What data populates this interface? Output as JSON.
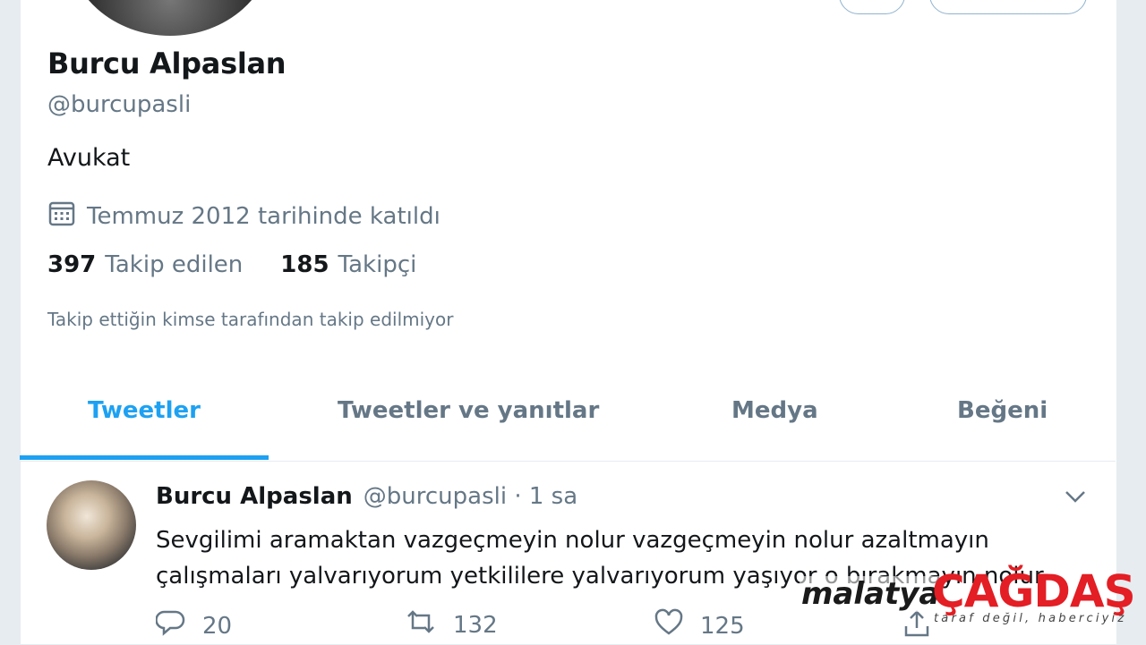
{
  "profile": {
    "name": "Burcu Alpaslan",
    "handle": "@burcupasli",
    "bio": "Avukat",
    "joined": "Temmuz 2012 tarihinde katıldı",
    "following_count": "397",
    "following_label": "Takip edilen",
    "followers_count": "185",
    "followers_label": "Takipçi",
    "followed_by_note": "Takip ettiğin kimse tarafından takip edilmiyor"
  },
  "tabs": [
    {
      "label": "Tweetler",
      "active": true
    },
    {
      "label": "Tweetler ve yanıtlar",
      "active": false
    },
    {
      "label": "Medya",
      "active": false
    },
    {
      "label": "Beğeni",
      "active": false
    }
  ],
  "tweet": {
    "author": "Burcu Alpaslan",
    "meta": "@burcupasli · 1 sa",
    "text": "Sevgilimi aramaktan vazgeçmeyin nolur vazgeçmeyin nolur azaltmayın çalışmaları yalvarıyorum yetkililere yalvarıyorum yaşıyor o bırakmayın nolur",
    "replies": "20",
    "retweets": "132",
    "likes": "125"
  },
  "watermark": {
    "brand_left": "malatya",
    "brand_right": "ÇAĞDAŞ",
    "slogan": "taraf değil, haberciyiz"
  },
  "colors": {
    "accent": "#1da1f2",
    "text": "#14171a",
    "muted": "#657786",
    "brand_red": "#e31e24"
  },
  "icons": [
    "calendar-icon",
    "reply-icon",
    "retweet-icon",
    "like-icon",
    "share-icon",
    "chevron-down-icon"
  ]
}
